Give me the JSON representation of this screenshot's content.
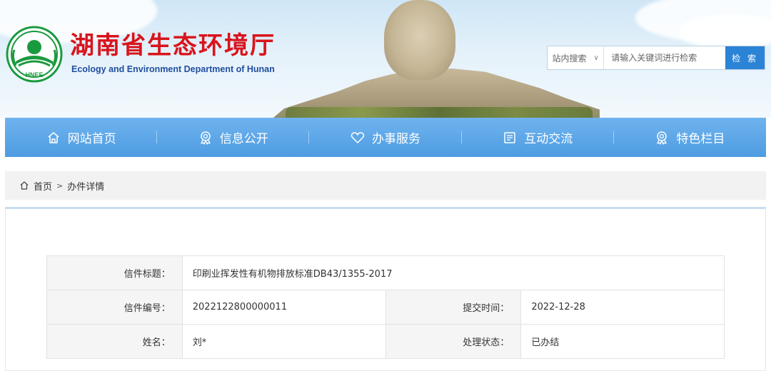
{
  "header": {
    "title": "湖南省生态环境厅",
    "subtitle": "Ecology and Environment Department of Hunan",
    "logo_text": "HNEE"
  },
  "search": {
    "scope_label": "站内搜索",
    "placeholder": "请输入关键词进行检索",
    "button_label": "检 索"
  },
  "nav": {
    "items": [
      {
        "label": "网站首页",
        "icon": "home-icon"
      },
      {
        "label": "信息公开",
        "icon": "badge-icon"
      },
      {
        "label": "办事服务",
        "icon": "heart-icon"
      },
      {
        "label": "互动交流",
        "icon": "document-icon"
      },
      {
        "label": "特色栏目",
        "icon": "badge-icon"
      }
    ]
  },
  "breadcrumb": {
    "home": "首页",
    "separator": ">",
    "current": "办件详情"
  },
  "detail": {
    "subject_label": "信件标题：",
    "subject_value": "印刷业挥发性有机物排放标准DB43/1355-2017",
    "number_label": "信件编号：",
    "number_value": "2022122800000011",
    "submit_time_label": "提交时间：",
    "submit_time_value": "2022-12-28",
    "name_label": "姓名：",
    "name_value": "刘*",
    "status_label": "处理状态：",
    "status_value": "已办结"
  },
  "colors": {
    "title_red": "#d9141c",
    "subtitle_blue": "#1f4fa0",
    "nav_blue": "#5aa5e8",
    "search_button": "#2b83d6"
  }
}
